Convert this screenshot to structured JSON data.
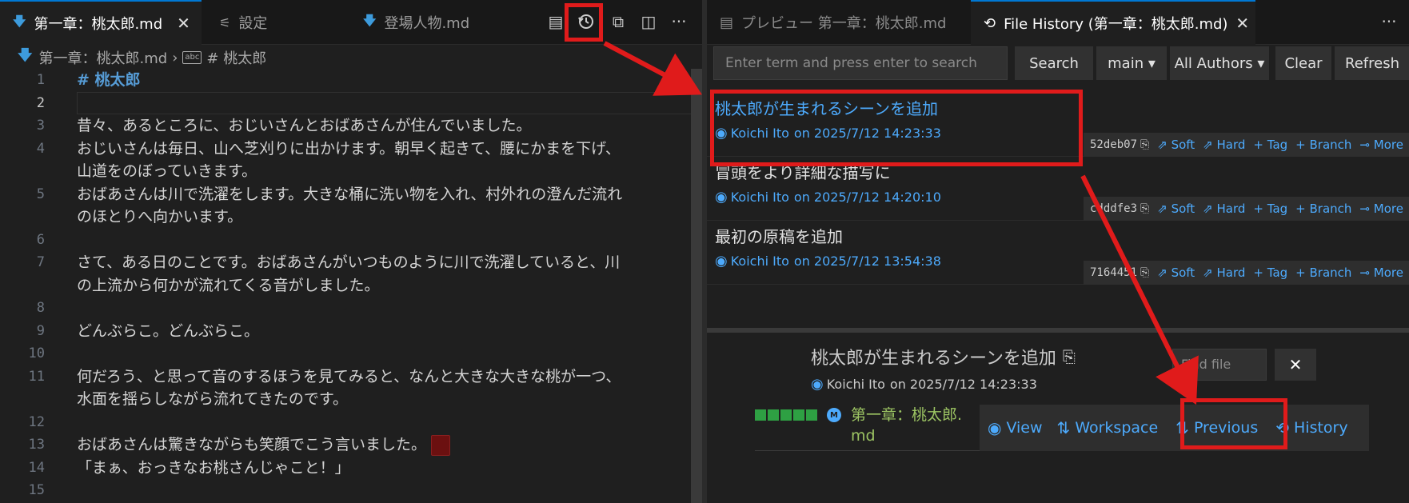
{
  "left_tabs": [
    {
      "label": "第一章：桃太郎.md",
      "active": true
    },
    {
      "label": "設定",
      "active": false
    },
    {
      "label": "登場人物.md",
      "active": false
    }
  ],
  "close_glyph": "✕",
  "more_glyph": "···",
  "breadcrumb": {
    "file": "第一章：桃太郎.md",
    "symbol": "# 桃太郎",
    "abc": "abc"
  },
  "editor_lines": [
    {
      "no": "1",
      "text": "# 桃太郎",
      "heading": true
    },
    {
      "no": "2",
      "text": ""
    },
    {
      "no": "3",
      "text": "昔々、あるところに、おじいさんとおばあさんが住んでいました。"
    },
    {
      "no": "4",
      "text": "おじいさんは毎日、山へ芝刈りに出かけます。朝早く起きて、腰にかまを下げ、"
    },
    {
      "no": "",
      "text": "山道をのぼっていきます。"
    },
    {
      "no": "5",
      "text": "おばあさんは川で洗濯をします。大きな桶に洗い物を入れ、村外れの澄んだ流れ"
    },
    {
      "no": "",
      "text": "のほとりへ向かいます。"
    },
    {
      "no": "6",
      "text": ""
    },
    {
      "no": "7",
      "text": "さて、ある日のことです。おばあさんがいつものように川で洗濯していると、川"
    },
    {
      "no": "",
      "text": "の上流から何かが流れてくる音がしました。"
    },
    {
      "no": "8",
      "text": ""
    },
    {
      "no": "9",
      "text": "どんぶらこ。どんぶらこ。"
    },
    {
      "no": "10",
      "text": ""
    },
    {
      "no": "11",
      "text": "何だろう、と思って音のするほうを見てみると、なんと大きな大きな桃が一つ、"
    },
    {
      "no": "",
      "text": "水面を揺らしながら流れてきたのです。"
    },
    {
      "no": "12",
      "text": ""
    },
    {
      "no": "13",
      "text": "おばあさんは驚きながらも笑顔でこう言いました。"
    },
    {
      "no": "14",
      "text": "「まぁ、おっきなお桃さんじゃこと！」"
    },
    {
      "no": "15",
      "text": ""
    }
  ],
  "right_tabs": [
    {
      "label": "プレビュー 第一章：桃太郎.md",
      "active": false
    },
    {
      "label": "File History (第一章：桃太郎.md)",
      "active": true
    }
  ],
  "search": {
    "placeholder": "Enter term and press enter to search",
    "search_label": "Search",
    "branch_label": "main ▾",
    "authors_label": "All Authors ▾",
    "clear_label": "Clear",
    "refresh_label": "Refresh"
  },
  "commits": [
    {
      "title": "桃太郎が生まれるシーンを追加",
      "author": "Koichi Ito",
      "date": "on 2025/7/12 14:23:33",
      "hash": "52deb07"
    },
    {
      "title": "冒頭をより詳細な描写に",
      "author": "Koichi Ito",
      "date": "on 2025/7/12 14:20:10",
      "hash": "cdddfe3"
    },
    {
      "title": "最初の原稿を追加",
      "author": "Koichi Ito",
      "date": "on 2025/7/12 13:54:38",
      "hash": "7164451"
    }
  ],
  "commit_actions": [
    "Soft",
    "Hard",
    "Tag",
    "Branch",
    "More"
  ],
  "detail": {
    "title": "桃太郎が生まれるシーンを追加",
    "author": "Koichi Ito",
    "date": "on 2025/7/12 14:23:33",
    "find_placeholder": "Find file",
    "find_close": "✕"
  },
  "file_entry": {
    "badge": "M",
    "name": "第一章：桃太郎.md",
    "actions": [
      "View",
      "Workspace",
      "Previous",
      "History"
    ]
  },
  "colors": {
    "accent": "#4daafc",
    "annotation": "#e01b1b",
    "added": "#2ea043",
    "modified_file": "#9cc463"
  }
}
